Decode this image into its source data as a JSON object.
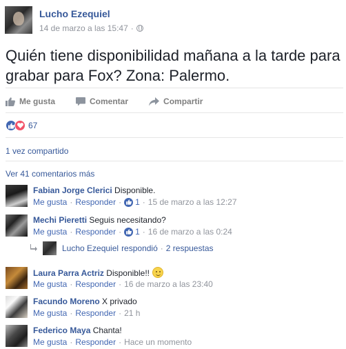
{
  "post": {
    "author": "Lucho Ezequiel",
    "timestamp": "14 de marzo a las 15:47",
    "separator": "·",
    "text": "Quién tiene disponibilidad mañana a la tarde para grabar para Fox? Zona: Palermo."
  },
  "actions": {
    "like": "Me gusta",
    "comment": "Comentar",
    "share": "Compartir"
  },
  "reactions": {
    "count": "67"
  },
  "shares": "1 vez compartido",
  "more_comments": "Ver 41 comentarios más",
  "comments": [
    {
      "name": "Fabian Jorge Clerici",
      "text": "Disponible.",
      "like": "Me gusta",
      "reply": "Responder",
      "likes": "1",
      "time": "15 de marzo a las 12:27"
    },
    {
      "name": "Mechi Pieretti",
      "text": "Seguis necesitando?",
      "like": "Me gusta",
      "reply": "Responder",
      "likes": "1",
      "time": "16 de marzo a las 0:24"
    },
    {
      "name": "Laura Parra Actriz",
      "text": "Disponible!!",
      "like": "Me gusta",
      "reply": "Responder",
      "time": "16 de marzo a las 23:40"
    },
    {
      "name": "Facundo Moreno",
      "text": "X privado",
      "like": "Me gusta",
      "reply": "Responder",
      "time": "21 h"
    },
    {
      "name": "Federico Maya",
      "text": "Chanta!",
      "like": "Me gusta",
      "reply": "Responder",
      "time": "Hace un momento"
    }
  ],
  "reply_thread": {
    "author": "Lucho Ezequiel",
    "verb": "respondió",
    "count": "2 respuestas"
  },
  "colors": {
    "link": "#365899",
    "like_blue": "#4267b2",
    "love_red": "#f25268",
    "muted": "#90949c"
  }
}
